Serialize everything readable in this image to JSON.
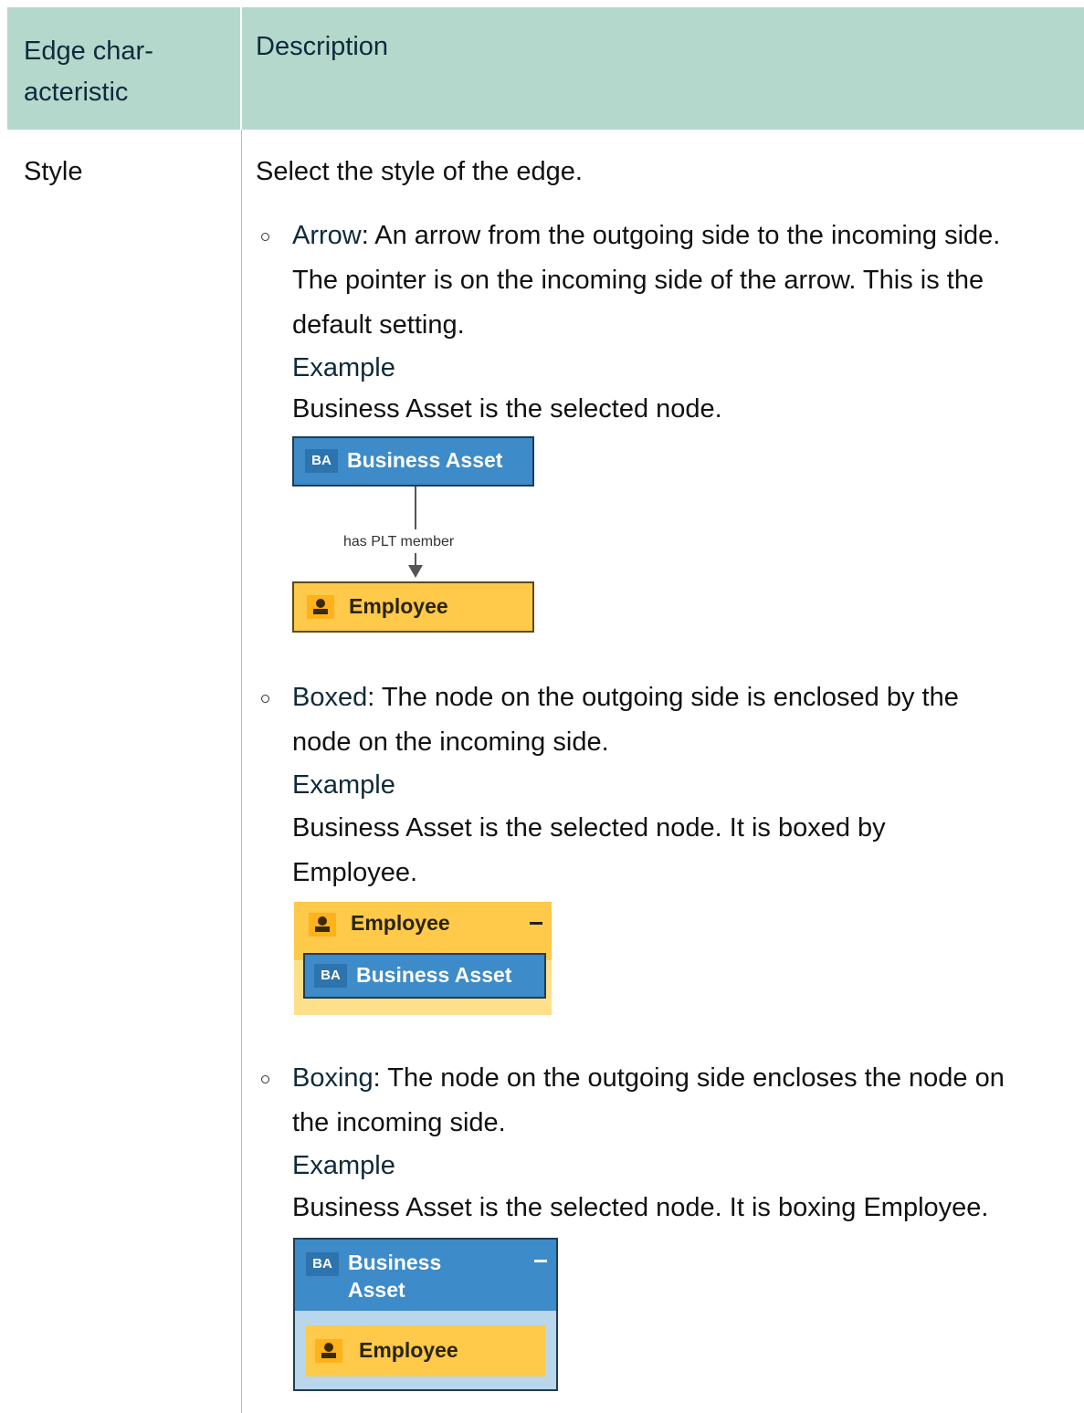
{
  "table": {
    "header": {
      "col1_line1": "Edge char-",
      "col1_line2": "acteristic",
      "col2": "Description"
    },
    "row": {
      "characteristic": "Style",
      "intro": "Select the style of the edge.",
      "items": [
        {
          "term": "Arrow",
          "lines": [
            ": An arrow from the outgoing side to the incoming side.",
            "The pointer is on the incoming side of the arrow. This is the",
            "default setting."
          ],
          "example_label": "Example",
          "example_text": [
            "Business Asset is the selected node."
          ]
        },
        {
          "term": "Boxed",
          "lines": [
            ": The node on the outgoing side is enclosed by the",
            "node on the incoming side."
          ],
          "example_label": "Example",
          "example_text": [
            "Business Asset is the selected node. It is boxed by",
            "Employee."
          ]
        },
        {
          "term": "Boxing",
          "lines": [
            ": The node on the outgoing side encloses the node on",
            "the incoming side."
          ],
          "example_label": "Example",
          "example_text": [
            "Business Asset is the selected node. It is boxing Employee."
          ]
        }
      ]
    }
  },
  "diagrams": {
    "arrow": {
      "source_badge": "BA",
      "source_label": "Business Asset",
      "edge_label": "has PLT member",
      "target_label": "Employee"
    },
    "boxed": {
      "outer_label": "Employee",
      "inner_badge": "BA",
      "inner_label": "Business Asset"
    },
    "boxing": {
      "outer_badge": "BA",
      "outer_label_line1": "Business",
      "outer_label_line2": "Asset",
      "inner_label": "Employee"
    }
  },
  "colors": {
    "header_bg": "#b5d8cd",
    "node_blue": "#3d8bc8",
    "node_yellow": "#ffc94a"
  },
  "icons": [
    "person-icon",
    "collapse-icon",
    "arrow-down-icon",
    "bullet-icon"
  ]
}
